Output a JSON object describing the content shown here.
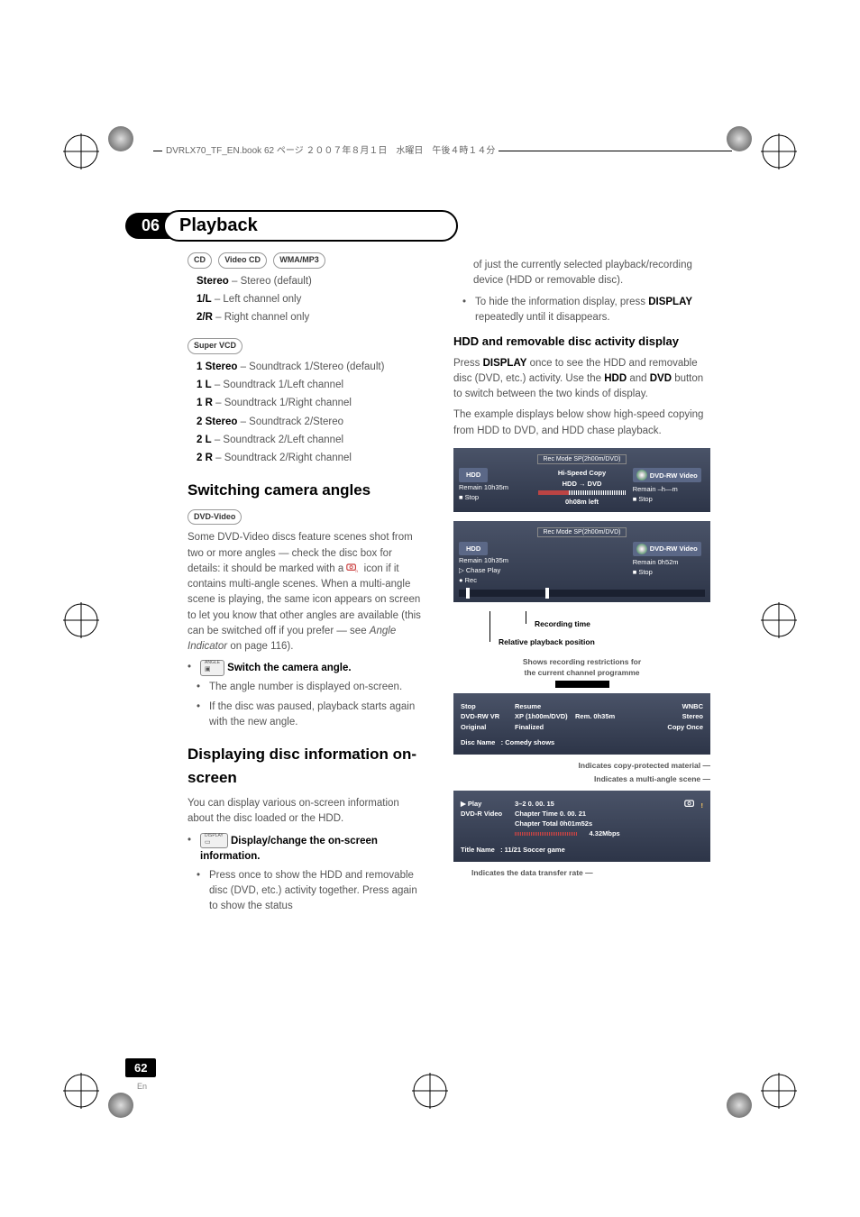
{
  "header_text": "DVRLX70_TF_EN.book  62 ページ  ２００７年８月１日　水曜日　午後４時１４分",
  "chapter": {
    "num": "06",
    "title": "Playback"
  },
  "formats1": [
    "CD",
    "Video CD",
    "WMA/MP3"
  ],
  "opts1": [
    {
      "b": "Stereo",
      "t": " – Stereo (default)"
    },
    {
      "b": "1/L",
      "t": " – Left channel only"
    },
    {
      "b": "2/R",
      "t": " – Right channel only"
    }
  ],
  "formats2": [
    "Super VCD"
  ],
  "opts2": [
    {
      "b": "1 Stereo",
      "t": " – Soundtrack 1/Stereo (default)"
    },
    {
      "b": "1 L",
      "t": " – Soundtrack 1/Left channel"
    },
    {
      "b": "1 R",
      "t": " – Soundtrack 1/Right channel"
    },
    {
      "b": "2 Stereo",
      "t": " – Soundtrack 2/Stereo"
    },
    {
      "b": "2 L",
      "t": " – Soundtrack 2/Left channel"
    },
    {
      "b": "2 R",
      "t": " – Soundtrack 2/Right channel"
    }
  ],
  "sec1_title": "Switching camera angles",
  "formats3": [
    "DVD-Video"
  ],
  "sec1_para": "Some DVD-Video discs feature scenes shot from two or more angles — check the disc box for details: it should be marked with a ",
  "sec1_para_b": " icon if it contains multi-angle scenes. When a multi-angle scene is playing, the same icon appears on screen to let you know that other angles are available (this can be switched off if you prefer — see ",
  "sec1_para_i": "Angle Indicator",
  "sec1_para_c": " on page 116).",
  "step1_btn": "ANGLE",
  "step1_text": "  Switch the camera angle.",
  "step1_sub1": "The angle number is displayed on-screen.",
  "step1_sub2": "If the disc was paused, playback starts again with the new angle.",
  "sec2_title": "Displaying disc information on-screen",
  "sec2_para": "You can display various on-screen information about the disc loaded or the HDD.",
  "step2_btn": "DISPLAY",
  "step2_text": "  Display/change the on-screen information.",
  "step2_sub1": "Press once to show the HDD and removable disc (DVD, etc.) activity together. Press again to show the status ",
  "right_cont": "of just the currently selected playback/recording device (HDD or removable disc).",
  "right_b1a": "To hide the information display, press ",
  "right_b1b": "DISPLAY",
  "right_b1c": " repeatedly until it disappears.",
  "sec3_title": "HDD and removable disc activity display",
  "sec3_p1a": "Press ",
  "sec3_p1b": "DISPLAY",
  "sec3_p1c": " once to see the HDD and removable disc (DVD, etc.) activity. Use the ",
  "sec3_p1d": "HDD",
  "sec3_p1e": " and ",
  "sec3_p1f": "DVD",
  "sec3_p1g": " button to switch between the two kinds of display.",
  "sec3_p2": "The example displays below show high-speed copying from HDD to DVD, and HDD chase playback.",
  "osd1": {
    "mode": "Rec Mode   SP(2h00m/DVD)",
    "hdd": "HDD",
    "remain1": "Remain  10h35m",
    "stop1": "Stop",
    "copy": "Hi-Speed Copy",
    "dir": "HDD → DVD",
    "left": "0h08m left",
    "dvd": "DVD-RW Video",
    "remain2": "Remain  –h—m",
    "stop2": "Stop"
  },
  "osd2": {
    "mode": "Rec Mode   SP(2h00m/DVD)",
    "hdd": "HDD",
    "remain1": "Remain  10h35m",
    "chase": "Chase Play",
    "rec": "Rec",
    "dvd": "DVD-RW Video",
    "remain2": "Remain  0h52m",
    "stop2": "Stop"
  },
  "callout1": "Recording time",
  "callout2": "Relative playback position",
  "label1a": "Shows recording restrictions for",
  "label1b": "the current channel programme",
  "info1": {
    "l1": "Stop",
    "l2": "DVD-RW  VR",
    "l3": "Original",
    "m1": "Resume",
    "m2": "XP (1h00m/DVD)",
    "m3": "Finalized",
    "rem": "Rem.    0h35m",
    "r1": "WNBC",
    "r2": "Stereo",
    "r3": "Copy Once",
    "dn": "Disc Name",
    "dv": ":  Comedy shows"
  },
  "label2": "Indicates copy-protected material",
  "label3": "Indicates a multi-angle scene",
  "info2": {
    "l1": "Play",
    "l2": "DVD-R  Video",
    "c1": "3–2        0. 00. 15",
    "c2": "Chapter Time     0. 00. 21",
    "c3": "Chapter Total    0h01m52s",
    "c4": "4.32Mbps",
    "tn": "Title Name",
    "tv": ":  11/21 Soccer game"
  },
  "label4": "Indicates the data transfer rate",
  "page_num": "62",
  "page_lang": "En"
}
